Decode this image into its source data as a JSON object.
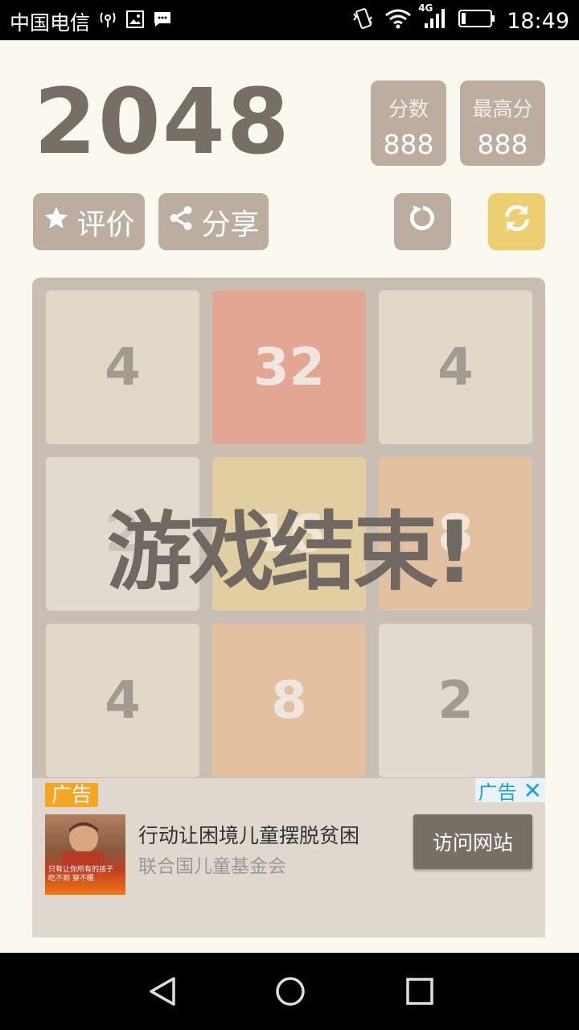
{
  "status_bar": {
    "carrier": "中国电信",
    "network": "4G",
    "time": "18:49"
  },
  "game": {
    "title": "2048",
    "score_label": "分数",
    "score_value": "888",
    "best_label": "最高分",
    "best_value": "888",
    "rate_label": "评价",
    "share_label": "分享",
    "game_over_text": "游戏结束!",
    "board": [
      [
        "4",
        "32",
        "4"
      ],
      [
        "2",
        "16",
        "8"
      ],
      [
        "4",
        "8",
        "2"
      ]
    ],
    "colors": {
      "background": "#faf8ef",
      "board": "#c9beb3",
      "button": "#bbada0",
      "restart_button": "#edcf72",
      "title": "#776e65"
    }
  },
  "ad": {
    "tag": "广告",
    "badge": "广告",
    "headline": "行动让困境儿童摆脱贫困",
    "advertiser": "联合国儿童基金会",
    "cta": "访问网站",
    "image_caption_1": "只有让你所有的孩子",
    "image_caption_2": "吃不到 穿不暖"
  }
}
